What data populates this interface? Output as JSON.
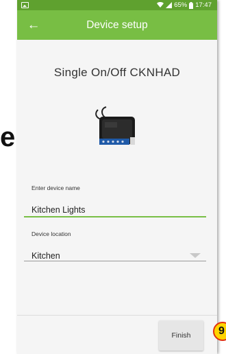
{
  "backdrop": {
    "text": "e"
  },
  "status_bar": {
    "battery": "65%",
    "time": "17:47"
  },
  "app_bar": {
    "title": "Device setup"
  },
  "device": {
    "title": "Single On/Off CKNHAD"
  },
  "form": {
    "name_label": "Enter device name",
    "name_value": "Kitchen Lights",
    "location_label": "Device location",
    "location_value": "Kitchen"
  },
  "footer": {
    "finish_label": "Finish"
  },
  "annotation": {
    "step": "9"
  },
  "colors": {
    "status_bar": "#5fa12f",
    "app_bar": "#78be44",
    "accent_line": "#78be44",
    "badge_fill": "#ffd400",
    "badge_border": "#e03010"
  },
  "icons": [
    "gallery-icon",
    "wifi-icon",
    "signal-icon",
    "battery-icon",
    "back-arrow-icon",
    "dropdown-arrow-icon"
  ]
}
